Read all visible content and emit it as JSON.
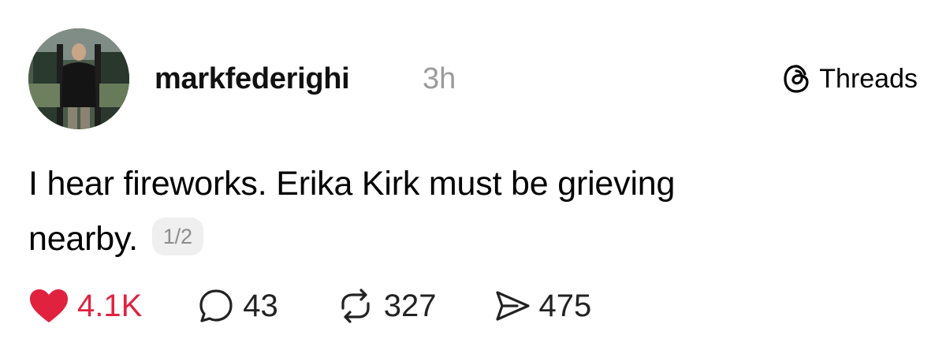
{
  "post": {
    "username": "markfederighi",
    "time": "3h",
    "brand_label": "Threads",
    "body_lines": [
      "I hear fireworks. Erika Kirk must be grieving",
      "nearby."
    ],
    "thread_position": "1/2"
  },
  "actions": {
    "likes": "4.1K",
    "replies": "43",
    "reposts": "327",
    "shares": "475"
  },
  "colors": {
    "like": "#e0223f",
    "timestamp": "#9b9b9b",
    "badge_bg": "#efefef"
  },
  "icons": [
    "threads-logo-icon",
    "heart-icon",
    "comment-icon",
    "repost-icon",
    "share-icon"
  ]
}
